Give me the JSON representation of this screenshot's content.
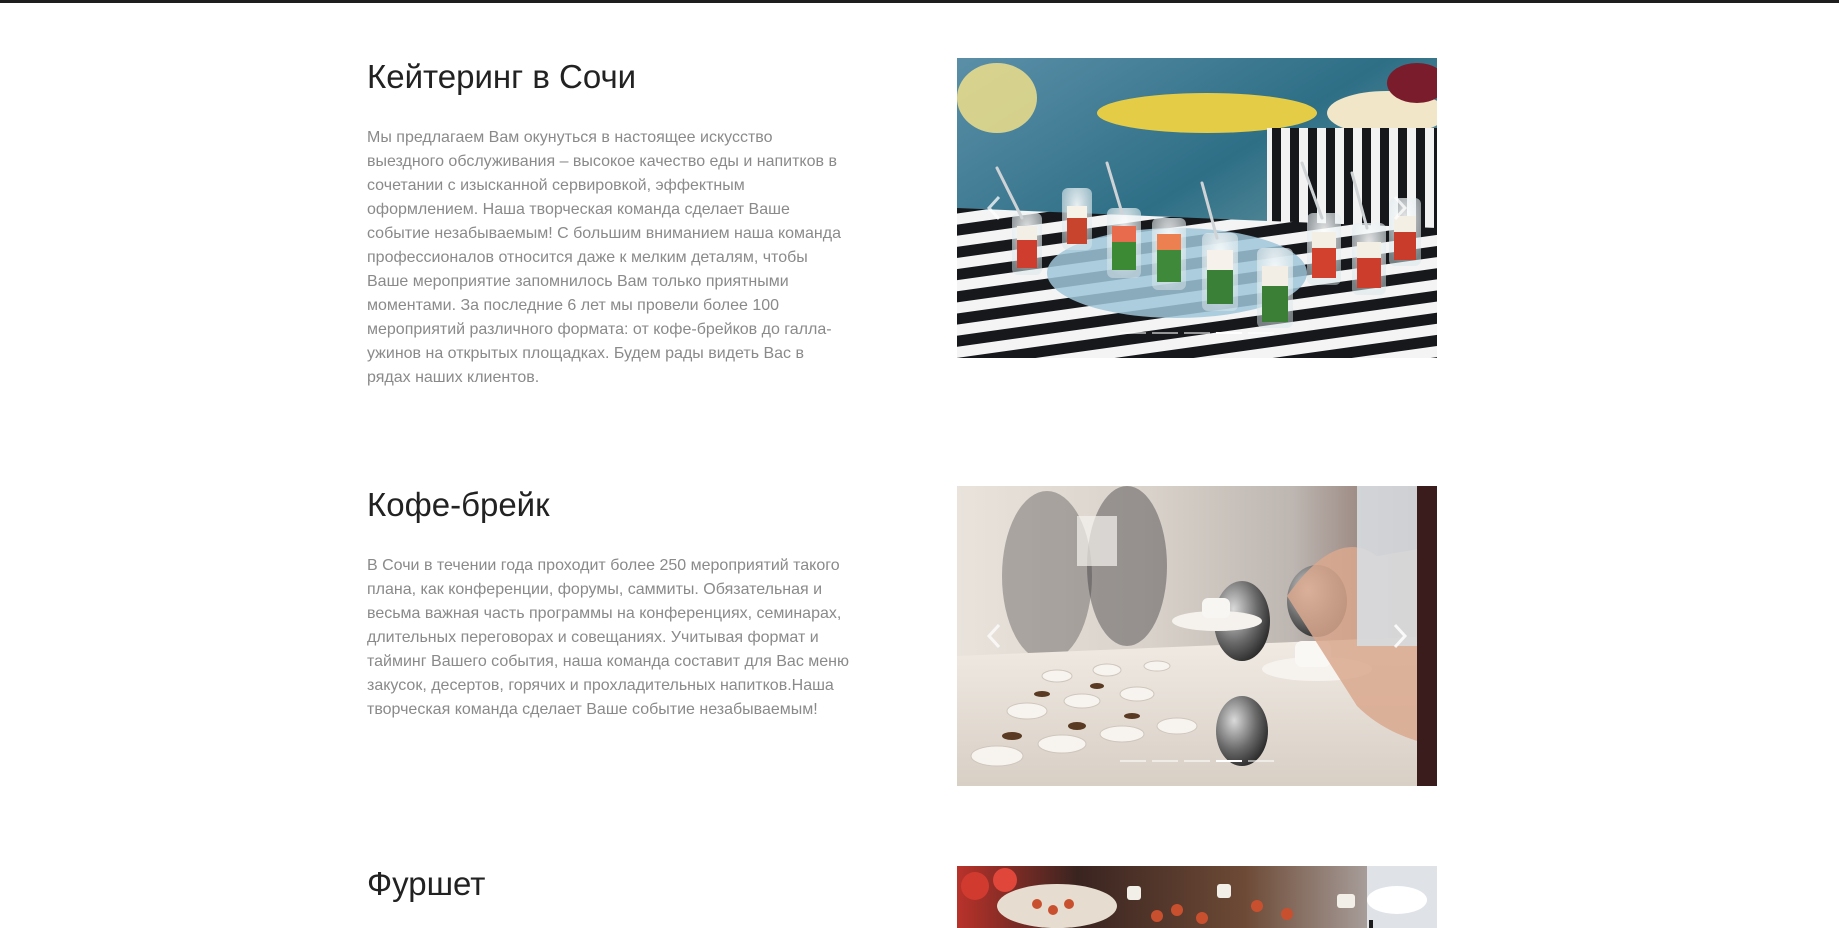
{
  "sections": [
    {
      "title": "Кейтеринг в Сочи",
      "paragraph": "Мы предлагаем Вам окунуться в настоящее искусство выездного обслуживания – высокое качество еды и напитков в сочетании с изысканной сервировкой, эффектным оформлением. Наша творческая команда сделает Ваше событие незабываемым! С большим вниманием наша команда профессионалов относится даже к мелким деталям, чтобы Ваше мероприятие запомнилось Вам только приятными моментами. За последние 6 лет мы провели более 100 мероприятий различного формата: от кофе-брейков до галла-ужинов на открытых площадках. Будем рады видеть Вас в рядах наших клиентов.",
      "slider": {
        "prev_icon": "chevron-left-icon",
        "next_icon": "chevron-right-icon",
        "active_slide": 4,
        "slides": 5
      }
    },
    {
      "title": "Кофе-брейк",
      "paragraph": "В Сочи в течении года проходит более 250 мероприятий такого плана, как конференции, форумы, саммиты. Обязательная и весьма важная часть программы на конференциях, семинарах, длительных переговорах и совещаниях. Учитывая формат и тайминг Вашего события, наша команда составит для Вас меню закусок, десертов, горячих и прохладительных напитков.Наша творческая команда сделает Ваше событие незабываемым!",
      "slider": {
        "prev_icon": "chevron-left-icon",
        "next_icon": "chevron-right-icon",
        "active_slide": 4,
        "slides": 5
      }
    },
    {
      "title": "Фуршет"
    }
  ],
  "colors": {
    "title": "#222222",
    "text": "#8a8a8a",
    "top_border": "#1e1e1e",
    "background": "#ffffff"
  }
}
